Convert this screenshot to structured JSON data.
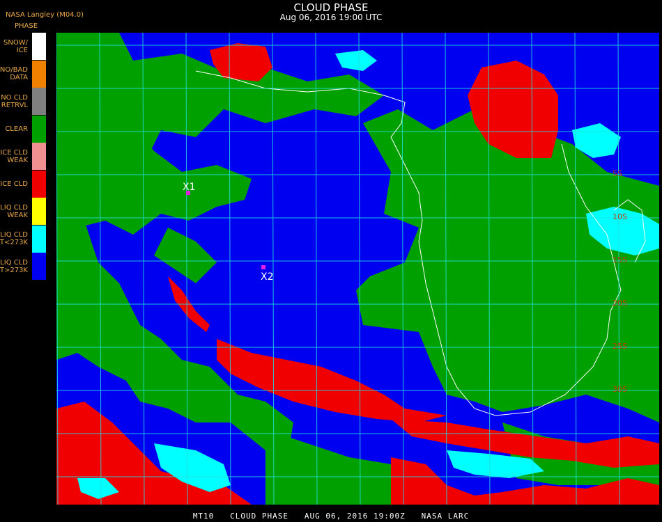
{
  "header": {
    "title": "CLOUD PHASE",
    "datetime": "Aug 06, 2016 19:00 UTC",
    "org": "NASA Langley (M04.0)",
    "legend_title": "PHASE"
  },
  "legend": [
    {
      "lines": [
        "SNOW/",
        "ICE"
      ],
      "color": "#ffffff"
    },
    {
      "lines": [
        "NO/BAD",
        "DATA"
      ],
      "color": "#f08000"
    },
    {
      "lines": [
        "NO CLD",
        "RETRVL"
      ],
      "color": "#808080"
    },
    {
      "lines": [
        "CLEAR"
      ],
      "color": "#00a000"
    },
    {
      "lines": [
        "ICE CLD",
        "WEAK"
      ],
      "color": "#f09090"
    },
    {
      "lines": [
        "ICE CLD"
      ],
      "color": "#f00000"
    },
    {
      "lines": [
        "LIQ CLD",
        "WEAK"
      ],
      "color": "#ffff00"
    },
    {
      "lines": [
        "LIQ CLD",
        "T<273K"
      ],
      "color": "#00ffff"
    },
    {
      "lines": [
        "LIQ CLD",
        "T>273K"
      ],
      "color": "#0000f0"
    }
  ],
  "map": {
    "markers": [
      {
        "label": "X1"
      },
      {
        "label": "X2"
      }
    ],
    "lat_labels": [
      "5S",
      "10S",
      "15S",
      "20S",
      "25S",
      "30S"
    ],
    "colors": {
      "liquid_warm": "#0000f0",
      "clear": "#00a000",
      "ice": "#f00000",
      "liquid_cold": "#00ffff",
      "grid": "#20e0e0",
      "coast": "#ffffff",
      "marker": "#e020e0",
      "lat_label": "#c04010"
    }
  },
  "footer": "MT10   CLOUD PHASE   AUG 06, 2016 19:00Z   NASA LARC"
}
